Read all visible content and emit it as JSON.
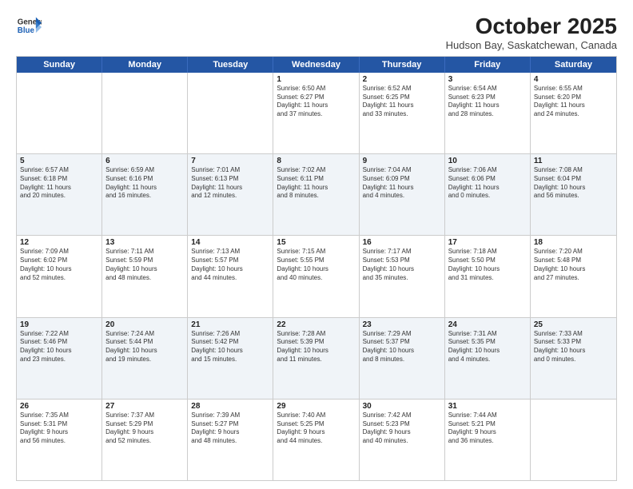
{
  "header": {
    "logo_line1": "General",
    "logo_line2": "Blue",
    "month_year": "October 2025",
    "location": "Hudson Bay, Saskatchewan, Canada"
  },
  "days_of_week": [
    "Sunday",
    "Monday",
    "Tuesday",
    "Wednesday",
    "Thursday",
    "Friday",
    "Saturday"
  ],
  "rows": [
    {
      "alt": false,
      "cells": [
        {
          "day": "",
          "text": ""
        },
        {
          "day": "",
          "text": ""
        },
        {
          "day": "",
          "text": ""
        },
        {
          "day": "1",
          "text": "Sunrise: 6:50 AM\nSunset: 6:27 PM\nDaylight: 11 hours\nand 37 minutes."
        },
        {
          "day": "2",
          "text": "Sunrise: 6:52 AM\nSunset: 6:25 PM\nDaylight: 11 hours\nand 33 minutes."
        },
        {
          "day": "3",
          "text": "Sunrise: 6:54 AM\nSunset: 6:23 PM\nDaylight: 11 hours\nand 28 minutes."
        },
        {
          "day": "4",
          "text": "Sunrise: 6:55 AM\nSunset: 6:20 PM\nDaylight: 11 hours\nand 24 minutes."
        }
      ]
    },
    {
      "alt": true,
      "cells": [
        {
          "day": "5",
          "text": "Sunrise: 6:57 AM\nSunset: 6:18 PM\nDaylight: 11 hours\nand 20 minutes."
        },
        {
          "day": "6",
          "text": "Sunrise: 6:59 AM\nSunset: 6:16 PM\nDaylight: 11 hours\nand 16 minutes."
        },
        {
          "day": "7",
          "text": "Sunrise: 7:01 AM\nSunset: 6:13 PM\nDaylight: 11 hours\nand 12 minutes."
        },
        {
          "day": "8",
          "text": "Sunrise: 7:02 AM\nSunset: 6:11 PM\nDaylight: 11 hours\nand 8 minutes."
        },
        {
          "day": "9",
          "text": "Sunrise: 7:04 AM\nSunset: 6:09 PM\nDaylight: 11 hours\nand 4 minutes."
        },
        {
          "day": "10",
          "text": "Sunrise: 7:06 AM\nSunset: 6:06 PM\nDaylight: 11 hours\nand 0 minutes."
        },
        {
          "day": "11",
          "text": "Sunrise: 7:08 AM\nSunset: 6:04 PM\nDaylight: 10 hours\nand 56 minutes."
        }
      ]
    },
    {
      "alt": false,
      "cells": [
        {
          "day": "12",
          "text": "Sunrise: 7:09 AM\nSunset: 6:02 PM\nDaylight: 10 hours\nand 52 minutes."
        },
        {
          "day": "13",
          "text": "Sunrise: 7:11 AM\nSunset: 5:59 PM\nDaylight: 10 hours\nand 48 minutes."
        },
        {
          "day": "14",
          "text": "Sunrise: 7:13 AM\nSunset: 5:57 PM\nDaylight: 10 hours\nand 44 minutes."
        },
        {
          "day": "15",
          "text": "Sunrise: 7:15 AM\nSunset: 5:55 PM\nDaylight: 10 hours\nand 40 minutes."
        },
        {
          "day": "16",
          "text": "Sunrise: 7:17 AM\nSunset: 5:53 PM\nDaylight: 10 hours\nand 35 minutes."
        },
        {
          "day": "17",
          "text": "Sunrise: 7:18 AM\nSunset: 5:50 PM\nDaylight: 10 hours\nand 31 minutes."
        },
        {
          "day": "18",
          "text": "Sunrise: 7:20 AM\nSunset: 5:48 PM\nDaylight: 10 hours\nand 27 minutes."
        }
      ]
    },
    {
      "alt": true,
      "cells": [
        {
          "day": "19",
          "text": "Sunrise: 7:22 AM\nSunset: 5:46 PM\nDaylight: 10 hours\nand 23 minutes."
        },
        {
          "day": "20",
          "text": "Sunrise: 7:24 AM\nSunset: 5:44 PM\nDaylight: 10 hours\nand 19 minutes."
        },
        {
          "day": "21",
          "text": "Sunrise: 7:26 AM\nSunset: 5:42 PM\nDaylight: 10 hours\nand 15 minutes."
        },
        {
          "day": "22",
          "text": "Sunrise: 7:28 AM\nSunset: 5:39 PM\nDaylight: 10 hours\nand 11 minutes."
        },
        {
          "day": "23",
          "text": "Sunrise: 7:29 AM\nSunset: 5:37 PM\nDaylight: 10 hours\nand 8 minutes."
        },
        {
          "day": "24",
          "text": "Sunrise: 7:31 AM\nSunset: 5:35 PM\nDaylight: 10 hours\nand 4 minutes."
        },
        {
          "day": "25",
          "text": "Sunrise: 7:33 AM\nSunset: 5:33 PM\nDaylight: 10 hours\nand 0 minutes."
        }
      ]
    },
    {
      "alt": false,
      "cells": [
        {
          "day": "26",
          "text": "Sunrise: 7:35 AM\nSunset: 5:31 PM\nDaylight: 9 hours\nand 56 minutes."
        },
        {
          "day": "27",
          "text": "Sunrise: 7:37 AM\nSunset: 5:29 PM\nDaylight: 9 hours\nand 52 minutes."
        },
        {
          "day": "28",
          "text": "Sunrise: 7:39 AM\nSunset: 5:27 PM\nDaylight: 9 hours\nand 48 minutes."
        },
        {
          "day": "29",
          "text": "Sunrise: 7:40 AM\nSunset: 5:25 PM\nDaylight: 9 hours\nand 44 minutes."
        },
        {
          "day": "30",
          "text": "Sunrise: 7:42 AM\nSunset: 5:23 PM\nDaylight: 9 hours\nand 40 minutes."
        },
        {
          "day": "31",
          "text": "Sunrise: 7:44 AM\nSunset: 5:21 PM\nDaylight: 9 hours\nand 36 minutes."
        },
        {
          "day": "",
          "text": ""
        }
      ]
    }
  ]
}
